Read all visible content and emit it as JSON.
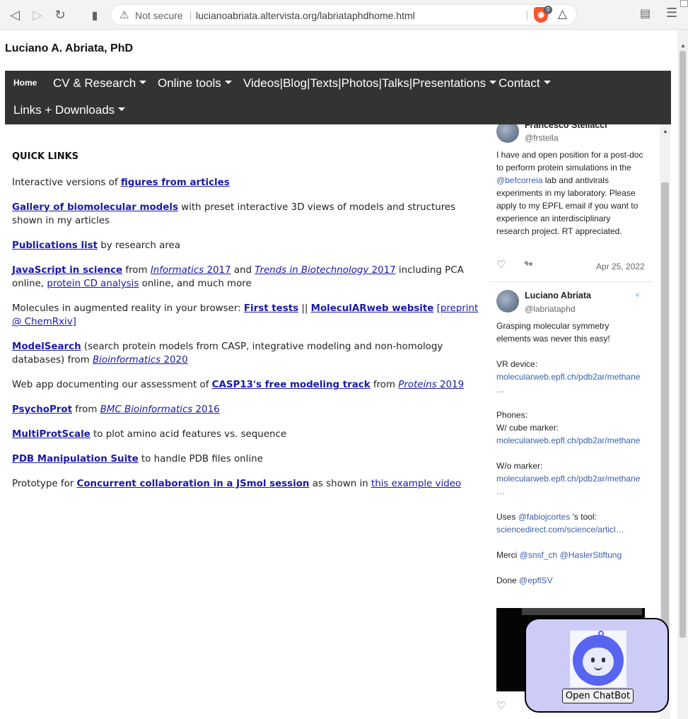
{
  "browser": {
    "url_security": "Not secure",
    "url": "lucianoabriata.altervista.org/labriataphdhome.html",
    "brave_badge": "9"
  },
  "site": {
    "title": "Luciano A. Abriata, PhD"
  },
  "nav": {
    "home": "Home",
    "cv": "CV & Research",
    "tools": "Online tools",
    "media": "Videos|Blog|Texts|Photos|Talks|Presentations",
    "contact": "Contact",
    "links": "Links + Downloads"
  },
  "content": {
    "quick_links": "QUICK LINKS",
    "p1": {
      "pre": "Interactive versions of ",
      "link": "figures from articles"
    },
    "p2": {
      "link": "Gallery of biomolecular models",
      "post": " with preset interactive 3D views of models and structures shown in my articles"
    },
    "p3": {
      "link": "Publications list",
      "post": " by research area"
    },
    "p4": {
      "link": "JavaScript in science",
      "t1": " from ",
      "l2": "Informatics",
      "l2b": " 2017",
      "t2": " and ",
      "l3": "Trends in Biotechnology",
      "l3b": " 2017",
      "t3": " including PCA online, ",
      "l4": "protein CD analysis",
      "t4": " online, and much more"
    },
    "p5": {
      "pre": "Molecules in augmented reality in your browser: ",
      "l1": "First tests",
      "t1": " || ",
      "l2": "MoleculARweb website",
      "t2": " ",
      "l3": "[preprint @ ChemRxiv]"
    },
    "p6": {
      "link": "ModelSearch",
      "t1": " (search protein models from CASP, integrative modeling and non-homology databases) from ",
      "l2": "Bioinformatics",
      "l2b": " 2020"
    },
    "p7": {
      "pre": "Web app documenting our assessment of ",
      "l1": "CASP13's free modeling track",
      "t1": " from ",
      "l2": "Proteins",
      "l2b": " 2019"
    },
    "p8": {
      "link": "PsychoProt",
      "t1": " from ",
      "l2": "BMC Bioinformatics",
      "l2b": " 2016"
    },
    "p9": {
      "link": "MultiProtScale",
      "post": " to plot amino acid features vs. sequence"
    },
    "p10": {
      "link": "PDB Manipulation Suite",
      "post": " to handle PDB files online"
    },
    "p11": {
      "pre": "Prototype for ",
      "l1": "Concurrent collaboration in a JSmol session",
      "t1": " as shown in ",
      "l2": "this example video"
    }
  },
  "twitter": {
    "t1": {
      "name": "Francesco Stellacci",
      "handle": "@frstella",
      "lines": [
        "I have and open position for a post-doc",
        "to perform protein simulations in the",
        "lab and antivirals",
        "experiments in my laboratory. Please",
        "apply to my EPFL email if you want to",
        "experience an interdisciplinary",
        "research project. RT appreciated."
      ],
      "mention": "@befcorreia",
      "date": "Apr 25, 2022"
    },
    "t2": {
      "name": "Luciano Abriata",
      "handle": "@labriataphd",
      "l1": "Grasping molecular symmetry",
      "l2": "elements was never this easy!",
      "vr": "VR device:",
      "link1": "molecularweb.epfl.ch/pdb2ar/methane",
      "ell1": "…",
      "phones": "Phones:",
      "cube": "W/ cube marker:",
      "link2": "molecularweb.epfl.ch/pdb2ar/methane",
      "womarker": "W/o marker:",
      "link3": "molecularweb.epfl.ch/pdb2ar/methane",
      "ell3": "…",
      "uses_pre": "Uses ",
      "uses_mention": "@fabiojcortes",
      "uses_post": " 's tool:",
      "link4": "sciencedirect.com/science/articl…",
      "merci_pre": "Merci ",
      "merci_m1": "@snsf_ch",
      "merci_m2": "@HaslerStiftung",
      "done_pre": "Done ",
      "done_m": "@epflSV"
    }
  },
  "chatbot": {
    "button": "Open ChatBot"
  }
}
